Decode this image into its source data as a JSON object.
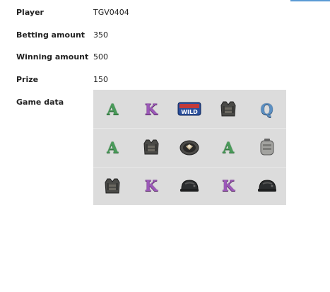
{
  "fields": [
    {
      "label": "Player",
      "value": "TGV0404"
    },
    {
      "label": "Betting amount",
      "value": "350"
    },
    {
      "label": "Winning amount",
      "value": "500"
    },
    {
      "label": "Prize",
      "value": "150"
    }
  ],
  "game_data_label": "Game data",
  "symbols": [
    [
      "A",
      "K",
      "wild-icon",
      "vest-icon",
      "Q"
    ],
    [
      "A",
      "vest-icon",
      "pan-icon",
      "A",
      "bag-icon"
    ],
    [
      "vest-icon",
      "K",
      "helmet-icon",
      "K",
      "helmet-icon"
    ]
  ],
  "wild_text": "WILD",
  "colors": {
    "grid_bg": "#dcdcdc",
    "A": "#4a9b5a",
    "K": "#9b58b8",
    "Q": "#5b8fc2"
  }
}
